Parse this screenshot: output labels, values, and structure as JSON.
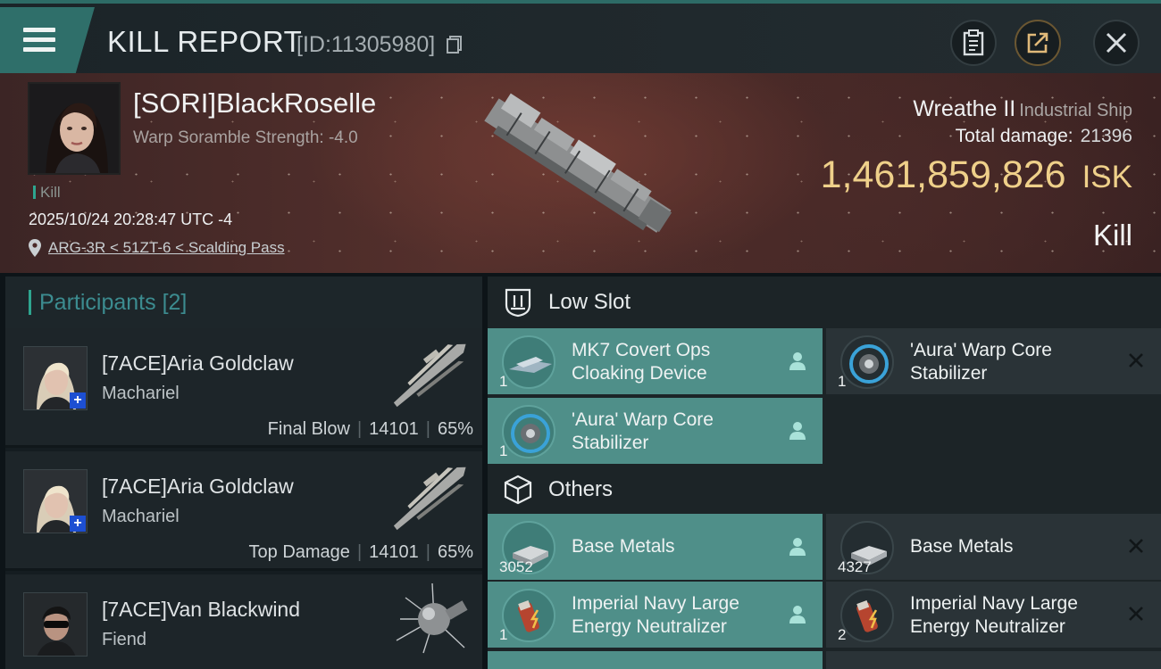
{
  "header": {
    "title": "KILL REPORT",
    "report_id": "[ID:11305980]"
  },
  "victim": {
    "name": "[SORI]BlackRoselle",
    "warp_scramble": "Warp Soramble Strength: -4.0",
    "kill_tag": "Kill",
    "timestamp": "2025/10/24 20:28:47 UTC -4",
    "location": "ARG-3R < 51ZT-6 < Scalding Pass",
    "ship_name": "Wreathe II",
    "ship_class": "Industrial Ship",
    "total_damage_label": "Total damage:",
    "total_damage": "21396",
    "isk_value": "1,461,859,826",
    "isk_unit": "ISK",
    "result": "Kill"
  },
  "participants": {
    "title": "Participants",
    "count": "[2]",
    "rows": [
      {
        "name": "[7ACE]Aria Goldclaw",
        "ship": "Machariel",
        "role": "Final Blow",
        "damage": "14101",
        "percent": "65%"
      },
      {
        "name": "[7ACE]Aria Goldclaw",
        "ship": "Machariel",
        "role": "Top Damage",
        "damage": "14101",
        "percent": "65%"
      },
      {
        "name": "[7ACE]Van Blackwind",
        "ship": "Fiend"
      }
    ]
  },
  "fittings": {
    "low_slot": {
      "title": "Low Slot",
      "items": [
        {
          "line1": "MK7 Covert Ops",
          "line2": "Cloaking Device",
          "qty": "1",
          "status": "dropped"
        },
        {
          "line1": "'Aura' Warp Core",
          "line2": "Stabilizer",
          "qty": "1",
          "status": "destroyed"
        },
        {
          "line1": "'Aura' Warp Core",
          "line2": "Stabilizer",
          "qty": "1",
          "status": "dropped"
        }
      ]
    },
    "others": {
      "title": "Others",
      "items": [
        {
          "line1": "Base Metals",
          "qty": "3052",
          "status": "dropped"
        },
        {
          "line1": "Base Metals",
          "qty": "4327",
          "status": "destroyed"
        },
        {
          "line1": "Imperial Navy Large",
          "line2": "Energy Neutralizer",
          "qty": "1",
          "status": "dropped"
        },
        {
          "line1": "Imperial Navy Large",
          "line2": "Energy Neutralizer",
          "qty": "2",
          "status": "destroyed"
        }
      ]
    }
  },
  "colors": {
    "accent_teal": "#2ea58f",
    "active_slot": "#4f8f89",
    "isk_gold": "#efd08a"
  }
}
